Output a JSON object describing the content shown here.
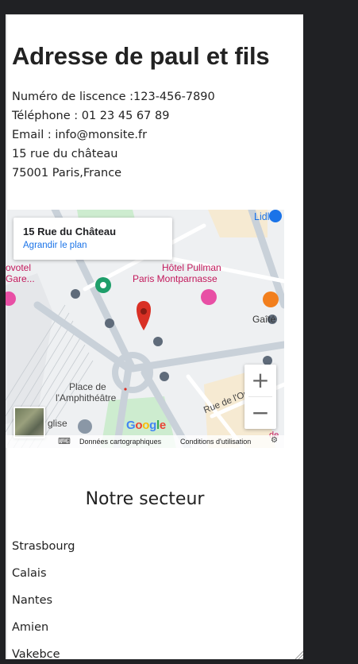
{
  "page": {
    "title": "Adresse de paul et fils",
    "license": "Numéro de liscence :123-456-7890",
    "phone": "Téléphone : 01 23 45 67 89",
    "email": "Email : info@monsite.fr",
    "street": "15 rue du château",
    "city": "75001 Paris,France"
  },
  "map": {
    "place_name": "15 Rue du Château",
    "place_link": "Agrandir le plan",
    "zoom_in": "+",
    "zoom_out": "−",
    "google_logo": "Google",
    "attrib_data": "Données cartographiques",
    "attrib_terms": "Conditions d'utilisation",
    "labels": {
      "lidl": "Lidl",
      "novotel_1": "ovotel",
      "novotel_2": "Gare...",
      "hotel_1": "Hôtel Pullman",
      "hotel_2": "Paris Montparnasse",
      "gaite": "Gaîté",
      "place_1": "Place de",
      "place_2": "l'Amphithéâtre",
      "eglise": "glise",
      "rue_ouest": "Rue de l'Ou",
      "de": "de"
    },
    "colors": {
      "red_pin": "#d93025",
      "road": "#c9d1d9",
      "park": "#cdeccf",
      "hotel_pink": "#e84fa5",
      "restaurant_orange": "#f27f1d",
      "label_pink": "#c2185b"
    }
  },
  "sector": {
    "title": "Notre secteur",
    "cities": [
      "Strasbourg",
      "Calais",
      "Nantes",
      "Amien",
      "Vakebce"
    ]
  }
}
